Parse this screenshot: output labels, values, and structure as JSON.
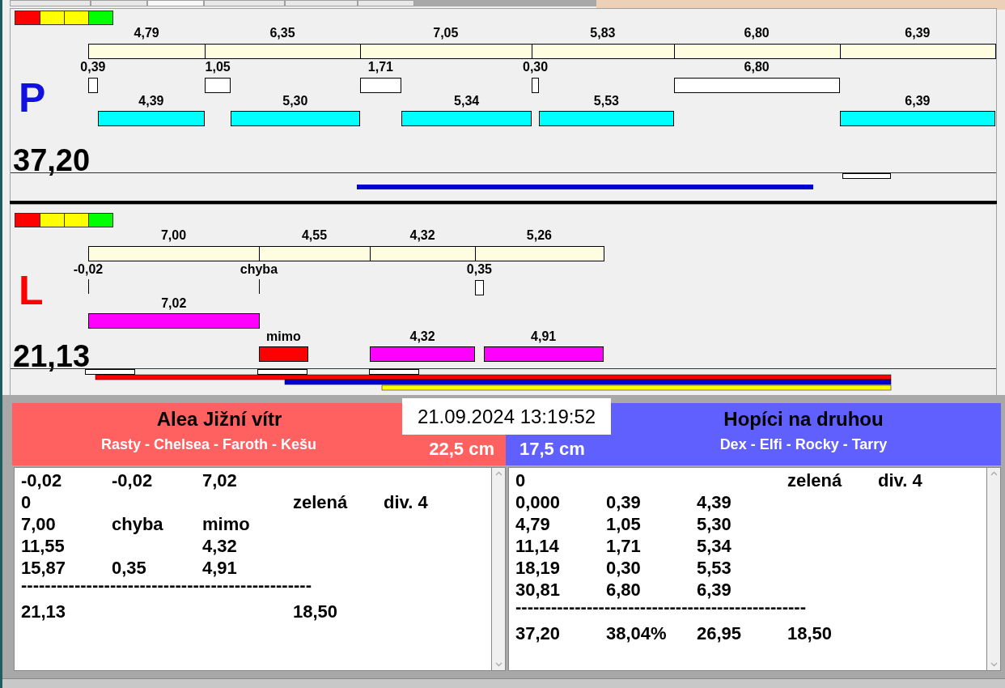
{
  "lanes": [
    {
      "letter": "P",
      "color": "#1010e0",
      "total": "37,20",
      "segments": [
        {
          "distance": "4,79",
          "fault": "0,39",
          "runs": [
            {
              "kind": "bar",
              "label": "4,39",
              "color": "#00ffff"
            }
          ]
        },
        {
          "distance": "6,35",
          "fault": "1,05",
          "runs": [
            {
              "kind": "bar",
              "label": "5,30",
              "color": "#00ffff"
            }
          ]
        },
        {
          "distance": "7,05",
          "fault": "1,71",
          "runs": [
            {
              "kind": "bar",
              "label": "5,34",
              "color": "#00ffff"
            }
          ]
        },
        {
          "distance": "5,83",
          "fault": "0,30",
          "runs": [
            {
              "kind": "bar",
              "label": "5,53",
              "color": "#00ffff"
            }
          ]
        },
        {
          "distance": "6,80",
          "fault": "6,80"
        },
        {
          "distance": "6,39",
          "runs": [
            {
              "kind": "bar",
              "label": "6,39",
              "color": "#00ffff"
            }
          ]
        }
      ]
    },
    {
      "letter": "L",
      "color": "#ff0000",
      "total": "21,13",
      "segments": [
        {
          "distance": "7,00",
          "fault": "-0,02",
          "runs": [
            {
              "kind": "bar",
              "label": "7,02",
              "color": "#ff00ff"
            }
          ]
        },
        {
          "distance": "4,55",
          "fault": "chyba",
          "runs": [
            {
              "kind": "miss",
              "label": "mimo",
              "color": "#ff0000"
            }
          ]
        },
        {
          "distance": "4,32",
          "runs": [
            {
              "kind": "bar_low",
              "label": "4,32",
              "color": "#ff00ff"
            }
          ]
        },
        {
          "distance": "5,26",
          "fault": "0,35",
          "runs": [
            {
              "kind": "bar_low",
              "label": "4,91",
              "color": "#ff00ff"
            }
          ]
        }
      ]
    }
  ],
  "timestamp": "21.09.2024 13:19:52",
  "teams": [
    {
      "title": "Alea Jižní vítr",
      "members": "Rasty - Chelsea - Faroth - Kešu",
      "height": "22,5 cm",
      "color": "#ff6060",
      "rows": [
        {
          "kind": "values",
          "column_1": "-0,02",
          "column_2": "-0,02",
          "column_3": "7,02"
        },
        {
          "kind": "values",
          "column_1": "0",
          "column_4": "zelená",
          "column_5": "div. 4"
        },
        {
          "kind": "values",
          "column_1": "7,00",
          "column_2": "chyba",
          "column_3": "mimo"
        },
        {
          "kind": "values",
          "column_1": "11,55",
          "column_3": "4,32"
        },
        {
          "kind": "values",
          "column_1": "15,87",
          "column_2": "0,35",
          "column_3": "4,91"
        },
        {
          "kind": "rule",
          "text": "-------------------------------------------------"
        },
        {
          "kind": "values",
          "column_1": "21,13",
          "column_4": "18,50"
        }
      ]
    },
    {
      "title": "Hopíci na druhou",
      "members": "Dex - Elfi - Rocky - Tarry",
      "height": "17,5 cm",
      "color": "#6060ff",
      "rows": [
        {
          "kind": "values",
          "column_1": "0",
          "column_4": "zelená",
          "column_5": "div. 4"
        },
        {
          "kind": "values",
          "column_1": "0,000",
          "column_2": "0,39",
          "column_3": "4,39"
        },
        {
          "kind": "values",
          "column_1": "4,79",
          "column_2": "1,05",
          "column_3": "5,30"
        },
        {
          "kind": "values",
          "column_1": "11,14",
          "column_2": "1,71",
          "column_3": "5,34"
        },
        {
          "kind": "values",
          "column_1": "18,19",
          "column_2": "0,30",
          "column_3": "5,53"
        },
        {
          "kind": "values",
          "column_1": "30,81",
          "column_2": "6,80",
          "column_3": "6,39"
        },
        {
          "kind": "rule",
          "text": "-------------------------------------------------"
        },
        {
          "kind": "values",
          "column_1": "37,20",
          "column_2": "38,04%",
          "column_3": "26,95",
          "column_4": "18,50"
        }
      ]
    }
  ]
}
